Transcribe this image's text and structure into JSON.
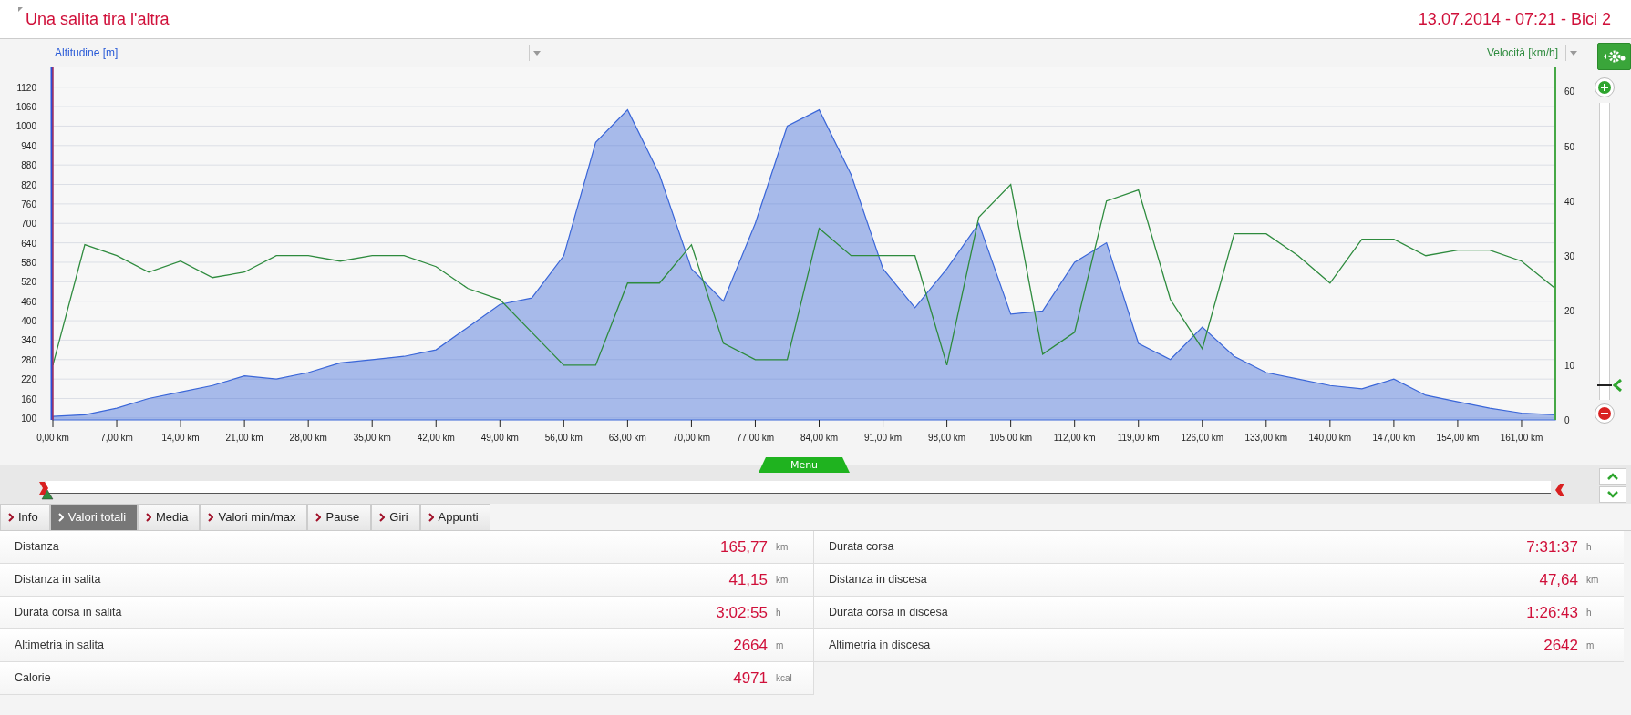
{
  "header": {
    "title": "Una salita tira l'altra",
    "info": "13.07.2014 - 07:21 - Bici 2"
  },
  "chart": {
    "chart_data": {
      "type": "area",
      "x": [
        0,
        3.5,
        7,
        10.5,
        14,
        17.5,
        21,
        24.5,
        28,
        31.5,
        35,
        38.5,
        42,
        45.5,
        49,
        52.5,
        56,
        59.5,
        63,
        66.5,
        70,
        73.5,
        77,
        80.5,
        84,
        87.5,
        91,
        94.5,
        98,
        101.5,
        105,
        108.5,
        112,
        115.5,
        119,
        122.5,
        126,
        129.5,
        133,
        136.5,
        140,
        143.5,
        147,
        150.5,
        154,
        157.5,
        161,
        164.7
      ],
      "series": [
        {
          "name": "Altitudine [m]",
          "color": "#3a66d8",
          "values": [
            105,
            110,
            130,
            160,
            180,
            200,
            230,
            220,
            240,
            270,
            280,
            290,
            310,
            380,
            450,
            470,
            600,
            950,
            1050,
            850,
            560,
            460,
            700,
            1000,
            1050,
            850,
            560,
            440,
            560,
            700,
            420,
            430,
            580,
            640,
            330,
            280,
            380,
            290,
            240,
            220,
            200,
            190,
            220,
            170,
            150,
            130,
            115,
            110
          ]
        },
        {
          "name": "Velocità [km/h]",
          "color": "#2e8b3e",
          "type": "line",
          "axis": "y2",
          "values": [
            10,
            32,
            30,
            27,
            29,
            26,
            27,
            30,
            30,
            29,
            30,
            30,
            28,
            24,
            22,
            16,
            10,
            10,
            25,
            25,
            32,
            14,
            11,
            11,
            35,
            30,
            30,
            30,
            10,
            37,
            43,
            12,
            16,
            40,
            42,
            22,
            13,
            34,
            34,
            30,
            25,
            33,
            33,
            30,
            31,
            31,
            29,
            24
          ]
        }
      ],
      "grid": true,
      "xlim": [
        0,
        164.7
      ],
      "ylim": [
        94,
        1181
      ],
      "y2lim": [
        0,
        64.4
      ],
      "xticks": [
        {
          "value": 0,
          "label": "0,00 km"
        },
        {
          "value": 7,
          "label": "7,00 km"
        },
        {
          "value": 14,
          "label": "14,00 km"
        },
        {
          "value": 21,
          "label": "21,00 km"
        },
        {
          "value": 28,
          "label": "28,00 km"
        },
        {
          "value": 35,
          "label": "35,00 km"
        },
        {
          "value": 42,
          "label": "42,00 km"
        },
        {
          "value": 49,
          "label": "49,00 km"
        },
        {
          "value": 56,
          "label": "56,00 km"
        },
        {
          "value": 63,
          "label": "63,00 km"
        },
        {
          "value": 70,
          "label": "70,00 km"
        },
        {
          "value": 77,
          "label": "77,00 km"
        },
        {
          "value": 84,
          "label": "84,00 km"
        },
        {
          "value": 91,
          "label": "91,00 km"
        },
        {
          "value": 98,
          "label": "98,00 km"
        },
        {
          "value": 105,
          "label": "105,00 km"
        },
        {
          "value": 112,
          "label": "112,00 km"
        },
        {
          "value": 119,
          "label": "119,00 km"
        },
        {
          "value": 126,
          "label": "126,00 km"
        },
        {
          "value": 133,
          "label": "133,00 km"
        },
        {
          "value": 140,
          "label": "140,00 km"
        },
        {
          "value": 147,
          "label": "147,00 km"
        },
        {
          "value": 154,
          "label": "154,00 km"
        },
        {
          "value": 161,
          "label": "161,00 km"
        }
      ],
      "yticks": [
        100,
        160,
        220,
        280,
        340,
        400,
        460,
        520,
        580,
        640,
        700,
        760,
        820,
        880,
        940,
        1000,
        1060,
        1120
      ],
      "y2ticks": [
        0,
        10,
        20,
        30,
        40,
        50,
        60
      ]
    }
  },
  "zoom_slider": {
    "level": 0.05
  },
  "timeline": {
    "menu_label": "Menu"
  },
  "tabs": [
    {
      "label": "Info",
      "selected": false
    },
    {
      "label": "Valori totali",
      "selected": true
    },
    {
      "label": "Media",
      "selected": false
    },
    {
      "label": "Valori min/max",
      "selected": false
    },
    {
      "label": "Pause",
      "selected": false
    },
    {
      "label": "Giri",
      "selected": false
    },
    {
      "label": "Appunti",
      "selected": false
    }
  ],
  "stats": {
    "left": [
      {
        "label": "Distanza",
        "value": "165,77",
        "unit": "km"
      },
      {
        "label": "Distanza in salita",
        "value": "41,15",
        "unit": "km"
      },
      {
        "label": "Durata corsa in salita",
        "value": "3:02:55",
        "unit": "h"
      },
      {
        "label": "Altimetria in salita",
        "value": "2664",
        "unit": "m"
      },
      {
        "label": "Calorie",
        "value": "4971",
        "unit": "kcal"
      }
    ],
    "right": [
      {
        "label": "Durata corsa",
        "value": "7:31:37",
        "unit": "h"
      },
      {
        "label": "Distanza in discesa",
        "value": "47,64",
        "unit": "km"
      },
      {
        "label": "Durata corsa in discesa",
        "value": "1:26:43",
        "unit": "h"
      },
      {
        "label": "Altimetria in discesa",
        "value": "2642",
        "unit": "m"
      }
    ]
  }
}
